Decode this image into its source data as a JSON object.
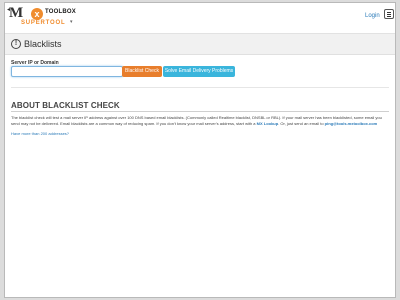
{
  "header": {
    "logo": {
      "mx": "M",
      "x": "x",
      "toolbox": "TOOLBOX",
      "supertool": "SUPERTOOL",
      "caret": "▾",
      "back_arrow": "◂"
    },
    "login_label": "Login",
    "menu_icon": "hamburger-icon"
  },
  "titlebar": {
    "icon": "alert-circle-icon",
    "icon_glyph": "!",
    "title": "Blacklists"
  },
  "form": {
    "label": "Server IP or Domain",
    "input_value": "",
    "check_button": "Blacklist Check",
    "solve_button": "Solve Email Delivery Problems"
  },
  "about": {
    "heading": "ABOUT BLACKLIST CHECK",
    "text_part1": "The blacklist check will test a mail server IP address against over 100 DNS based email blacklists. (Commonly called Realtime blacklist, DNSBL or RBL). If your mail server has been blacklisted, some email you send may not be delivered. Email blacklists are a common way of reducing spam. If you don't know your mail server's address, start with a ",
    "mx_lookup_link": "MX Lookup",
    "text_part2": ". Or, just send an email to ",
    "email_link": "ping@tools.mxtoolbox.com",
    "more_link": "Have more than 200 addresses?"
  },
  "colors": {
    "accent_orange": "#e87e2c",
    "accent_blue": "#3ab5dc",
    "link_blue": "#2a7ab8"
  }
}
